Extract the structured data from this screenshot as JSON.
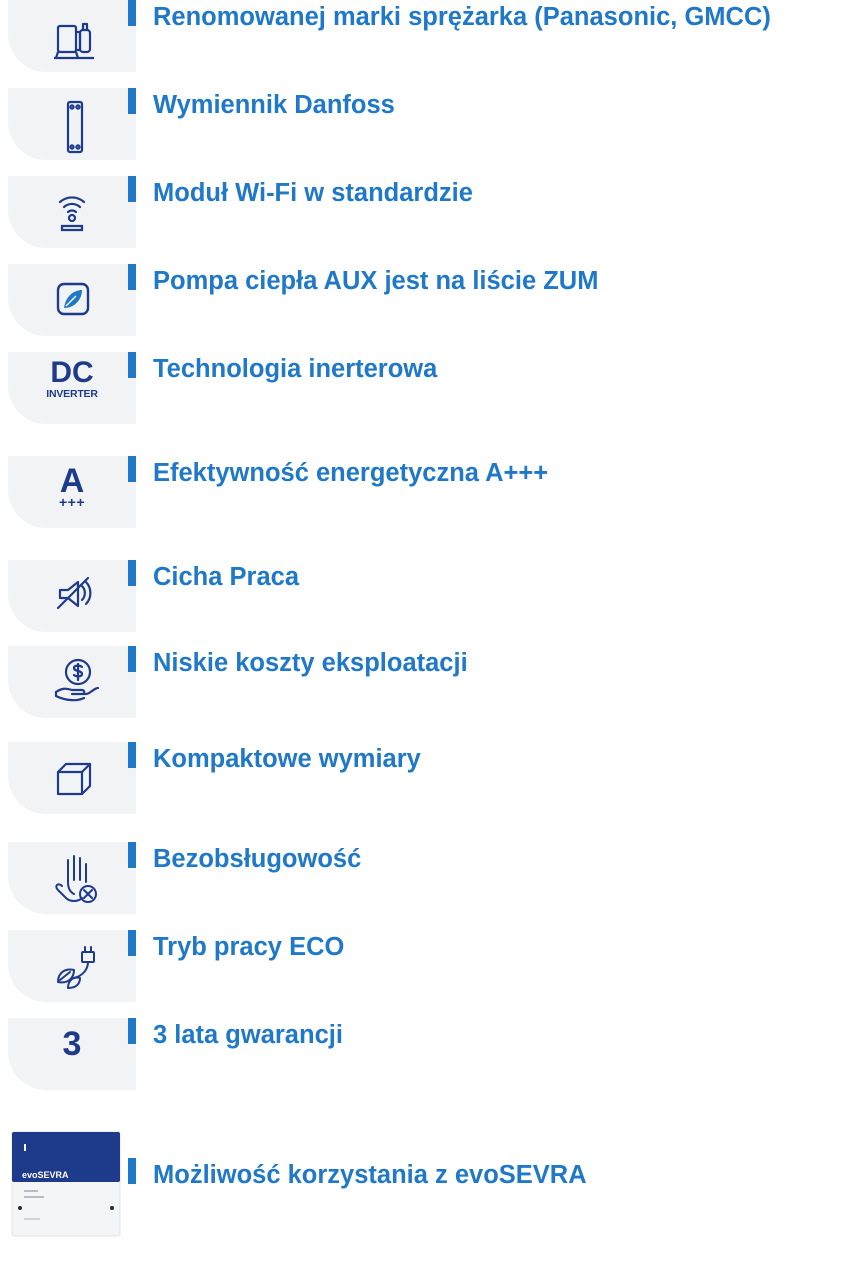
{
  "features": [
    {
      "label": "Renomowanej marki sprężarka (Panasonic, GMCC)",
      "icon": "compressor-icon"
    },
    {
      "label": "Wymiennik Danfoss",
      "icon": "heat-exchanger-icon"
    },
    {
      "label": "Moduł Wi-Fi w standardzie",
      "icon": "wifi-icon"
    },
    {
      "label": "Pompa ciepła AUX jest na liście ZUM",
      "icon": "leaf-badge-icon"
    },
    {
      "label": "Technologia inerterowa",
      "icon": "dc-inverter-icon",
      "icon_text": "DC",
      "icon_subtext": "INVERTER"
    },
    {
      "label": "Efektywność energetyczna A+++",
      "icon": "energy-class-icon",
      "icon_text": "A",
      "icon_subtext": "+++"
    },
    {
      "label": "Cicha Praca",
      "icon": "mute-speaker-icon"
    },
    {
      "label": "Niskie koszty eksploatacji",
      "icon": "money-hand-icon"
    },
    {
      "label": "Kompaktowe wymiary",
      "icon": "cube-icon"
    },
    {
      "label": "Bezobsługowość",
      "icon": "hand-cross-icon"
    },
    {
      "label": "Tryb pracy ECO",
      "icon": "eco-plug-leaf-icon"
    },
    {
      "label": "3 lata gwarancji",
      "icon": "warranty-icon",
      "icon_text": "3"
    },
    {
      "label": "Możliwość korzystania z evoSEVRA",
      "icon": "evosevra-device-icon",
      "icon_text": "evoSEVRA"
    }
  ],
  "colors": {
    "accent": "#1f78c8",
    "icon": "#1e3a8a",
    "tile": "#f2f3f5"
  }
}
